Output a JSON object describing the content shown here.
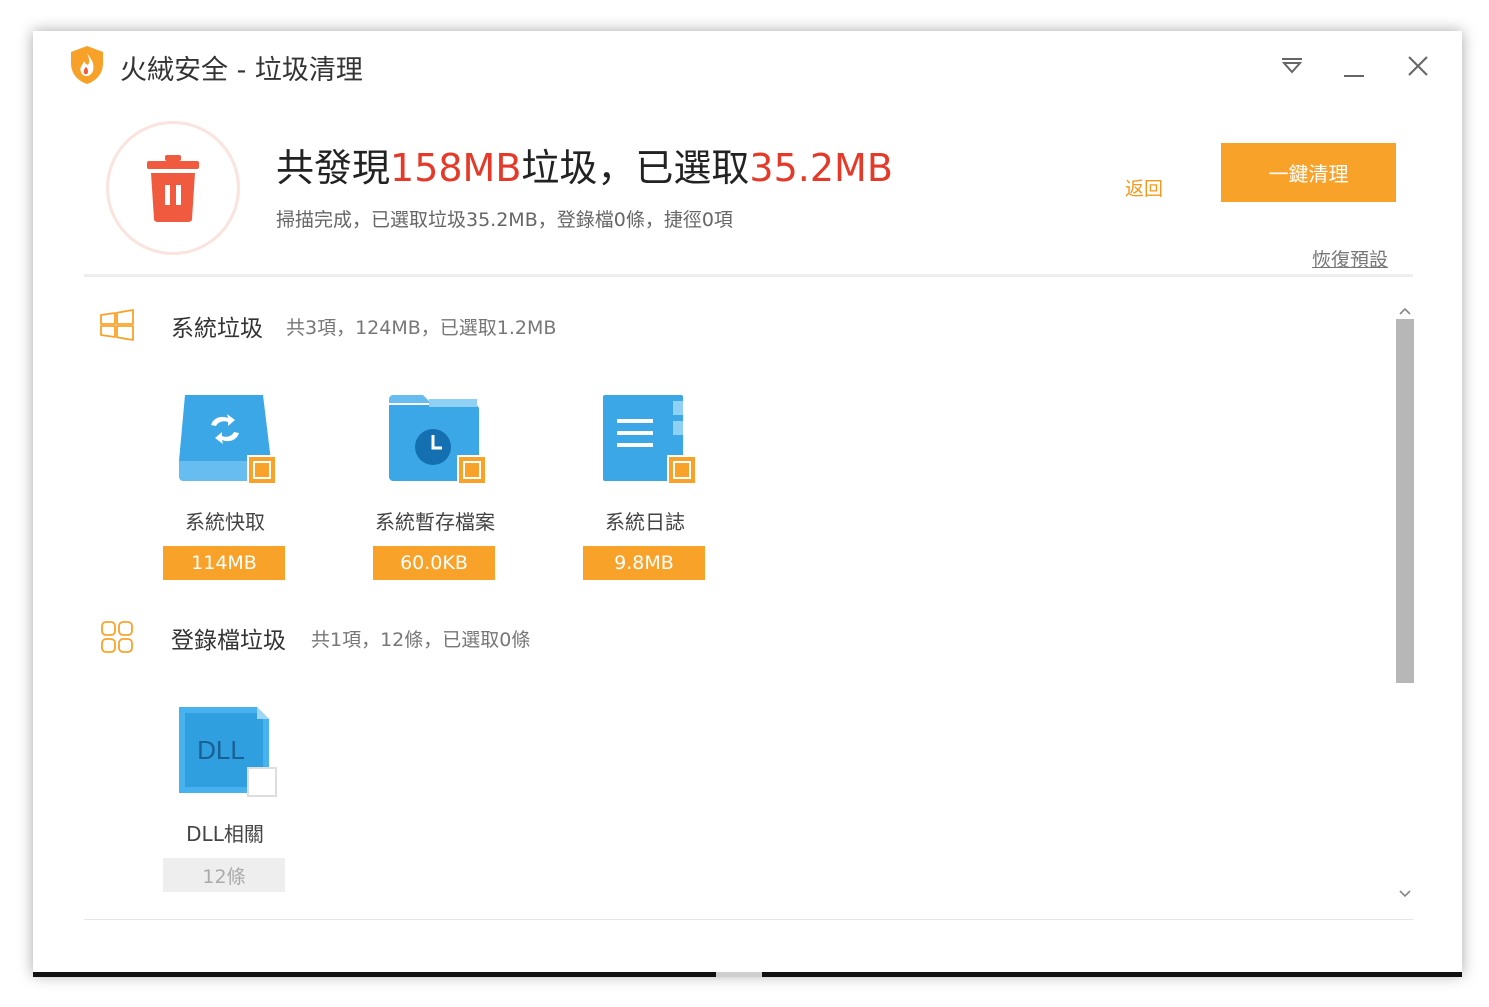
{
  "window": {
    "title": "火絨安全 - 垃圾清理"
  },
  "summary": {
    "headline_prefix": "共發現",
    "total_found": "158MB",
    "headline_middle": "垃圾，已選取",
    "selected": "35.2MB",
    "subline": "掃描完成，已選取垃圾35.2MB，登錄檔0條，捷徑0項",
    "back_label": "返回",
    "clean_label": "一鍵清理",
    "restore_label": "恢復預設"
  },
  "colors": {
    "accent": "#f9a22a",
    "highlight_red": "#e43a2a",
    "trash_icon": "#f05a3f",
    "file_icon_blue": "#47b2ee"
  },
  "sections": [
    {
      "title": "系統垃圾",
      "meta": "共3項，124MB，已選取1.2MB",
      "icon": "windows-icon",
      "items": [
        {
          "label": "系統快取",
          "size": "114MB",
          "icon": "cache-drive-icon",
          "checked": "partial"
        },
        {
          "label": "系統暫存檔案",
          "size": "60.0KB",
          "icon": "temp-folder-icon",
          "checked": "partial"
        },
        {
          "label": "系統日誌",
          "size": "9.8MB",
          "icon": "log-file-icon",
          "checked": "partial"
        }
      ]
    },
    {
      "title": "登錄檔垃圾",
      "meta": "共1項，12條，已選取0條",
      "icon": "registry-icon",
      "items": [
        {
          "label": "DLL相關",
          "size": "12條",
          "icon": "dll-file-icon",
          "checked": "none",
          "icon_text": "DLL"
        }
      ]
    }
  ]
}
